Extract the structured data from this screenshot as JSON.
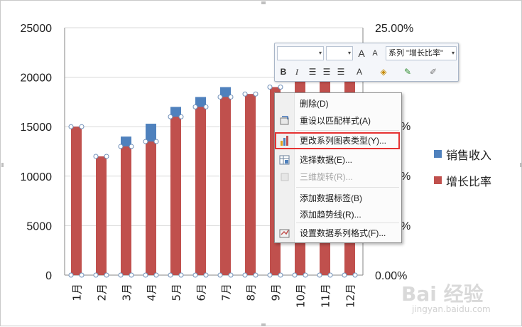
{
  "chart_data": {
    "type": "bar",
    "categories": [
      "1月",
      "2月",
      "3月",
      "4月",
      "5月",
      "6月",
      "7月",
      "8月",
      "9月",
      "10月",
      "11月",
      "12月"
    ],
    "series": [
      {
        "name": "销售收入",
        "color": "#4f81bd",
        "values": [
          15000,
          12000,
          14000,
          15300,
          17000,
          18000,
          19000,
          18300,
          19000,
          20000,
          20000,
          20000
        ]
      },
      {
        "name": "增长比率",
        "color": "#c0504d",
        "values": [
          15000,
          12000,
          13000,
          13500,
          16000,
          17000,
          18000,
          18300,
          19000,
          20000,
          20000,
          20000
        ]
      }
    ],
    "y_left": {
      "min": 0,
      "max": 25000,
      "ticks": [
        "0",
        "5000",
        "10000",
        "15000",
        "20000",
        "25000"
      ]
    },
    "y_right": {
      "visible_ticks": [
        "0.00%",
        "%",
        "%",
        "%",
        "25.00%"
      ]
    },
    "grid": true,
    "legend_position": "right"
  },
  "mini_toolbar": {
    "series_select": "系列 \"增长比率\"",
    "bold": "B",
    "italic": "I",
    "font_grow": "A",
    "font_shrink": "A",
    "font_color": "A"
  },
  "context_menu": {
    "items": [
      {
        "label": "删除(D)",
        "icon": "",
        "enabled": true
      },
      {
        "label": "重设以匹配样式(A)",
        "icon": "reset-style-icon",
        "enabled": true
      },
      {
        "label": "更改系列图表类型(Y)...",
        "icon": "bar-chart-icon",
        "enabled": true
      },
      {
        "label": "选择数据(E)...",
        "icon": "select-data-icon",
        "enabled": true
      },
      {
        "label": "三维旋转(R)...",
        "icon": "3d-rotate-icon",
        "enabled": false
      },
      {
        "label": "添加数据标签(B)",
        "icon": "",
        "enabled": true
      },
      {
        "label": "添加趋势线(R)...",
        "icon": "",
        "enabled": true
      },
      {
        "label": "设置数据系列格式(F)...",
        "icon": "format-series-icon",
        "enabled": true
      }
    ]
  },
  "watermark": {
    "text": "Bai 经验",
    "sub": "jingyan.baidu.com"
  }
}
